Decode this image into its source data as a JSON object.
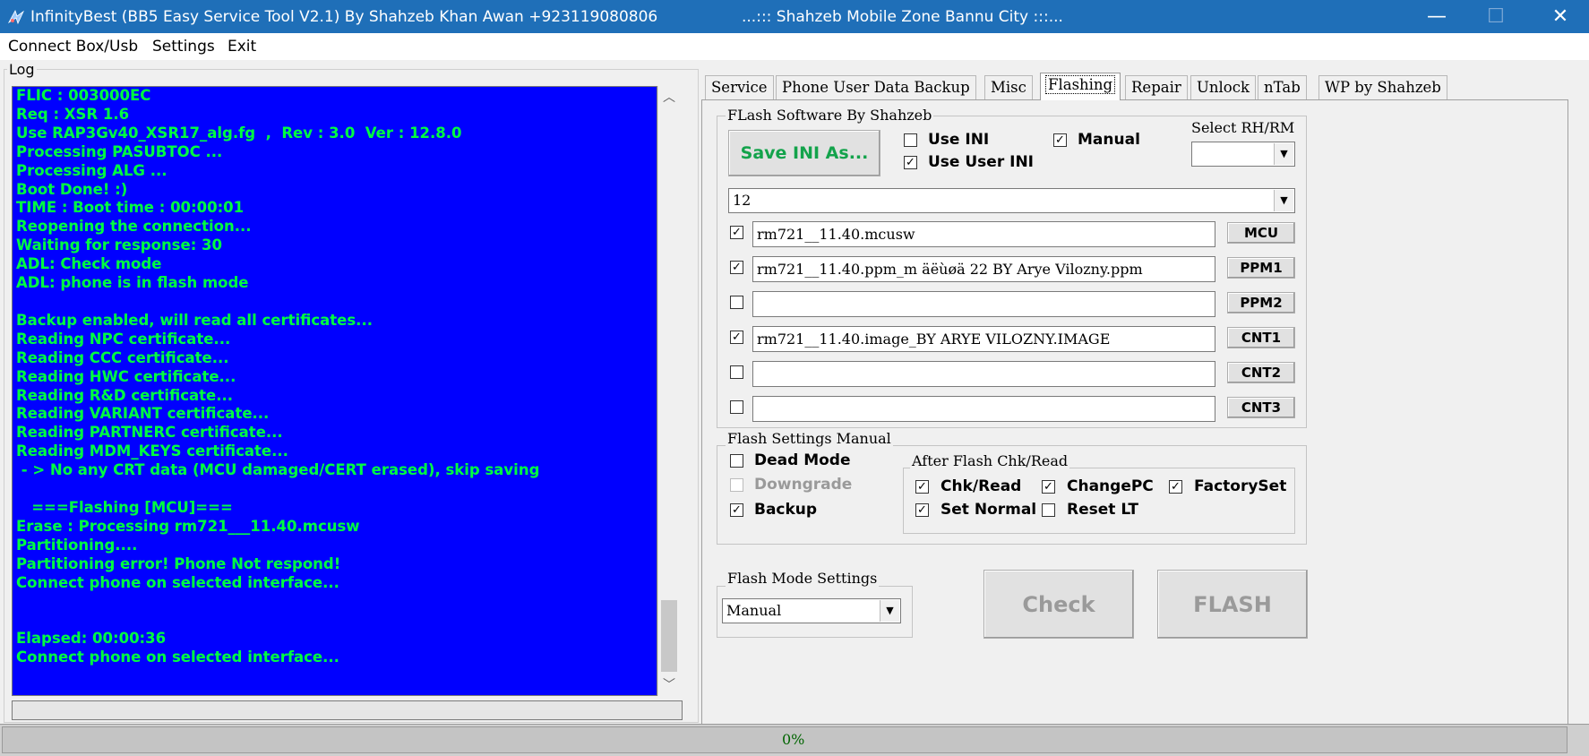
{
  "window": {
    "title": "InfinityBest (BB5 Easy Service Tool V2.1) By Shahzeb Khan Awan +923119080806",
    "subtitle": "...::: Shahzeb Mobile Zone Bannu City :::...",
    "minimize_glyph": "—",
    "maximize_glyph": "☐",
    "close_glyph": "✕"
  },
  "menu": [
    "Connect Box/Usb",
    "Settings",
    "Exit"
  ],
  "log": {
    "legend": "Log",
    "lines": [
      "FLIC : 003000EC",
      "Req : XSR 1.6",
      "Use RAP3Gv40_XSR17_alg.fg  ,  Rev : 3.0  Ver : 12.8.0",
      "Processing PASUBTOC ...",
      "Processing ALG ...",
      "Boot Done! :)",
      "TIME : Boot time : 00:00:01",
      "Reopening the connection...",
      "Waiting for response: 30",
      "ADL: Check mode",
      "ADL: phone is in flash mode",
      "",
      "Backup enabled, will read all certificates...",
      "Reading NPC certificate...",
      "Reading CCC certificate...",
      "Reading HWC certificate...",
      "Reading R&D certificate...",
      "Reading VARIANT certificate...",
      "Reading PARTNERC certificate...",
      "Reading MDM_KEYS certificate...",
      " - > No any CRT data (MCU damaged/CERT erased), skip saving",
      "",
      "   ===Flashing [MCU]===",
      "Erase : Processing rm721___11.40.mcusw",
      "Partitioning....",
      "Partitioning error! Phone Not respond!",
      "Connect phone on selected interface...",
      "",
      "",
      "Elapsed: 00:00:36",
      "Connect phone on selected interface..."
    ]
  },
  "tabs": [
    "Service",
    "Phone User Data Backup",
    "Misc",
    "Flashing",
    "Repair",
    "Unlock",
    "nTab",
    "WP by Shahzeb"
  ],
  "active_tab": "Flashing",
  "flash_software": {
    "legend": "FLash Software By Shahzeb",
    "save_ini_label": "Save INI As...",
    "use_ini_label": "Use INI",
    "use_ini_checked": false,
    "use_user_ini_label": "Use User INI",
    "use_user_ini_checked": true,
    "manual_label": "Manual",
    "manual_checked": true,
    "select_rhrm_label": "Select RH/RM",
    "select_rhrm_value": "",
    "version_value": "12",
    "files": [
      {
        "checked": true,
        "value": "rm721__11.40.mcusw",
        "button": "MCU"
      },
      {
        "checked": true,
        "value": "rm721__11.40.ppm_m äëùøä 22 BY Arye Vilozny.ppm",
        "button": "PPM1"
      },
      {
        "checked": false,
        "value": "",
        "button": "PPM2"
      },
      {
        "checked": true,
        "value": "rm721__11.40.image_BY ARYE VILOZNY.IMAGE",
        "button": "CNT1"
      },
      {
        "checked": false,
        "value": "",
        "button": "CNT2"
      },
      {
        "checked": false,
        "value": "",
        "button": "CNT3"
      }
    ]
  },
  "flash_settings": {
    "legend": "Flash Settings Manual",
    "dead_mode_label": "Dead Mode",
    "dead_mode_checked": false,
    "downgrade_label": "Downgrade",
    "downgrade_checked": false,
    "backup_label": "Backup",
    "backup_checked": true,
    "after_legend": "After Flash Chk/Read",
    "chk_read_label": "Chk/Read",
    "chk_read_checked": true,
    "changepc_label": "ChangePC",
    "changepc_checked": true,
    "factoryset_label": "FactorySet",
    "factoryset_checked": true,
    "set_normal_label": "Set Normal",
    "set_normal_checked": true,
    "reset_lt_label": "Reset LT",
    "reset_lt_checked": false
  },
  "flash_mode": {
    "legend": "Flash Mode Settings",
    "value": "Manual"
  },
  "check_label": "Check",
  "flash_label": "FLASH",
  "status": {
    "progress_text": "0%"
  },
  "colors": {
    "titlebar": "#1f6fb8",
    "log_bg": "#0000ff",
    "log_text": "#00ff40",
    "save_ini_text": "#13a34b"
  }
}
